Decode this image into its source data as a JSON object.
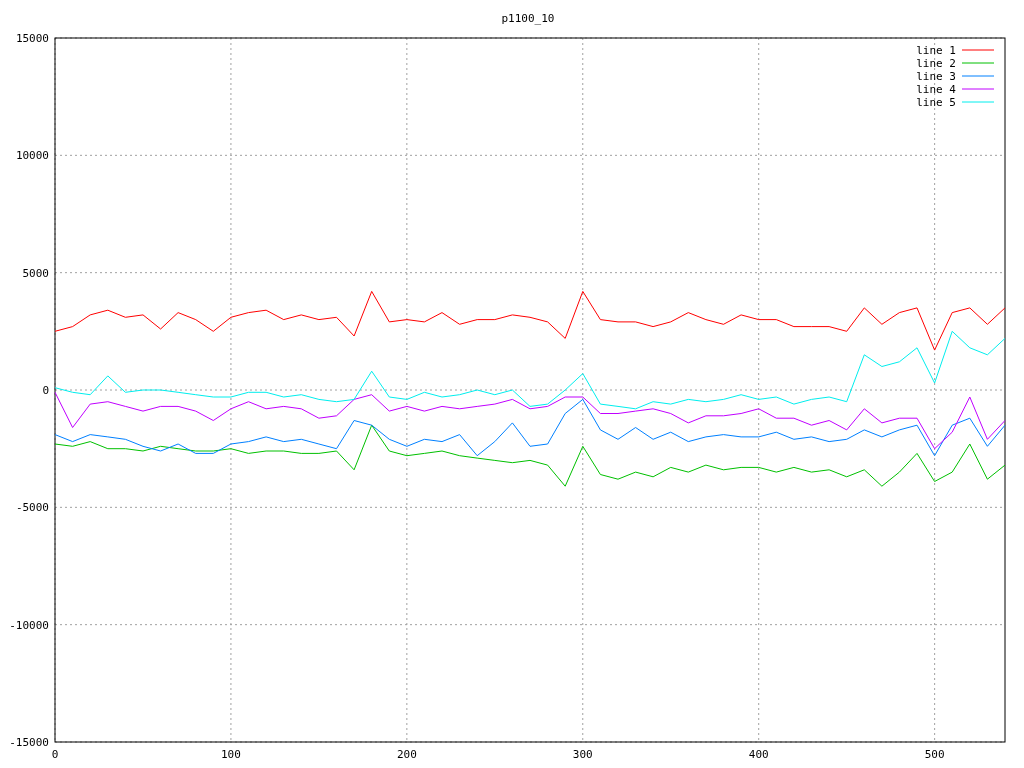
{
  "chart_data": {
    "type": "line",
    "title": "p1100_10",
    "grid": true,
    "legend": true,
    "xlim": [
      0,
      540
    ],
    "ylim": [
      -15000,
      15000
    ],
    "xticks": [
      0,
      100,
      200,
      300,
      400,
      500
    ],
    "yticks": [
      -15000,
      -10000,
      -5000,
      0,
      5000,
      10000,
      15000
    ],
    "x": [
      0,
      10,
      20,
      30,
      40,
      50,
      60,
      70,
      80,
      90,
      100,
      110,
      120,
      130,
      140,
      150,
      160,
      170,
      180,
      190,
      200,
      210,
      220,
      230,
      240,
      250,
      260,
      270,
      280,
      290,
      300,
      310,
      320,
      330,
      340,
      350,
      360,
      370,
      380,
      390,
      400,
      410,
      420,
      430,
      440,
      450,
      460,
      470,
      480,
      490,
      500,
      510,
      520,
      530,
      540
    ],
    "series": [
      {
        "name": "line 1",
        "color": "#ff0000",
        "values": [
          2500,
          2700,
          3200,
          3400,
          3100,
          3200,
          2600,
          3300,
          3000,
          2500,
          3100,
          3300,
          3400,
          3000,
          3200,
          3000,
          3100,
          2300,
          4200,
          2900,
          3000,
          2900,
          3300,
          2800,
          3000,
          3000,
          3200,
          3100,
          2900,
          2200,
          4200,
          3000,
          2900,
          2900,
          2700,
          2900,
          3300,
          3000,
          2800,
          3200,
          3000,
          3000,
          2700,
          2700,
          2700,
          2500,
          3500,
          2800,
          3300,
          3500,
          1700,
          3300,
          3500,
          2800,
          3500
        ]
      },
      {
        "name": "line 2",
        "color": "#00c000",
        "values": [
          -2300,
          -2400,
          -2200,
          -2500,
          -2500,
          -2600,
          -2400,
          -2500,
          -2600,
          -2600,
          -2500,
          -2700,
          -2600,
          -2600,
          -2700,
          -2700,
          -2600,
          -3400,
          -1500,
          -2600,
          -2800,
          -2700,
          -2600,
          -2800,
          -2900,
          -3000,
          -3100,
          -3000,
          -3200,
          -4100,
          -2400,
          -3600,
          -3800,
          -3500,
          -3700,
          -3300,
          -3500,
          -3200,
          -3400,
          -3300,
          -3300,
          -3500,
          -3300,
          -3500,
          -3400,
          -3700,
          -3400,
          -4100,
          -3500,
          -2700,
          -3900,
          -3500,
          -2300,
          -3800,
          -3200
        ]
      },
      {
        "name": "line 3",
        "color": "#0080ff",
        "values": [
          -1900,
          -2200,
          -1900,
          -2000,
          -2100,
          -2400,
          -2600,
          -2300,
          -2700,
          -2700,
          -2300,
          -2200,
          -2000,
          -2200,
          -2100,
          -2300,
          -2500,
          -1300,
          -1500,
          -2100,
          -2400,
          -2100,
          -2200,
          -1900,
          -2800,
          -2200,
          -1400,
          -2400,
          -2300,
          -1000,
          -400,
          -1700,
          -2100,
          -1600,
          -2100,
          -1800,
          -2200,
          -2000,
          -1900,
          -2000,
          -2000,
          -1800,
          -2100,
          -2000,
          -2200,
          -2100,
          -1700,
          -2000,
          -1700,
          -1500,
          -2800,
          -1500,
          -1200,
          -2400,
          -1500
        ]
      },
      {
        "name": "line 4",
        "color": "#c000ff",
        "values": [
          -100,
          -1600,
          -600,
          -500,
          -700,
          -900,
          -700,
          -700,
          -900,
          -1300,
          -800,
          -500,
          -800,
          -700,
          -800,
          -1200,
          -1100,
          -400,
          -200,
          -900,
          -700,
          -900,
          -700,
          -800,
          -700,
          -600,
          -400,
          -800,
          -700,
          -300,
          -300,
          -1000,
          -1000,
          -900,
          -800,
          -1000,
          -1400,
          -1100,
          -1100,
          -1000,
          -800,
          -1200,
          -1200,
          -1500,
          -1300,
          -1700,
          -800,
          -1400,
          -1200,
          -1200,
          -2500,
          -1800,
          -300,
          -2100,
          -1300
        ]
      },
      {
        "name": "line 5",
        "color": "#00eeee",
        "values": [
          100,
          -100,
          -200,
          600,
          -100,
          0,
          0,
          -100,
          -200,
          -300,
          -300,
          -100,
          -100,
          -300,
          -200,
          -400,
          -500,
          -400,
          800,
          -300,
          -400,
          -100,
          -300,
          -200,
          0,
          -200,
          0,
          -700,
          -600,
          0,
          700,
          -600,
          -700,
          -800,
          -500,
          -600,
          -400,
          -500,
          -400,
          -200,
          -400,
          -300,
          -600,
          -400,
          -300,
          -500,
          1500,
          1000,
          1200,
          1800,
          300,
          2500,
          1800,
          1500,
          2200
        ]
      }
    ]
  }
}
